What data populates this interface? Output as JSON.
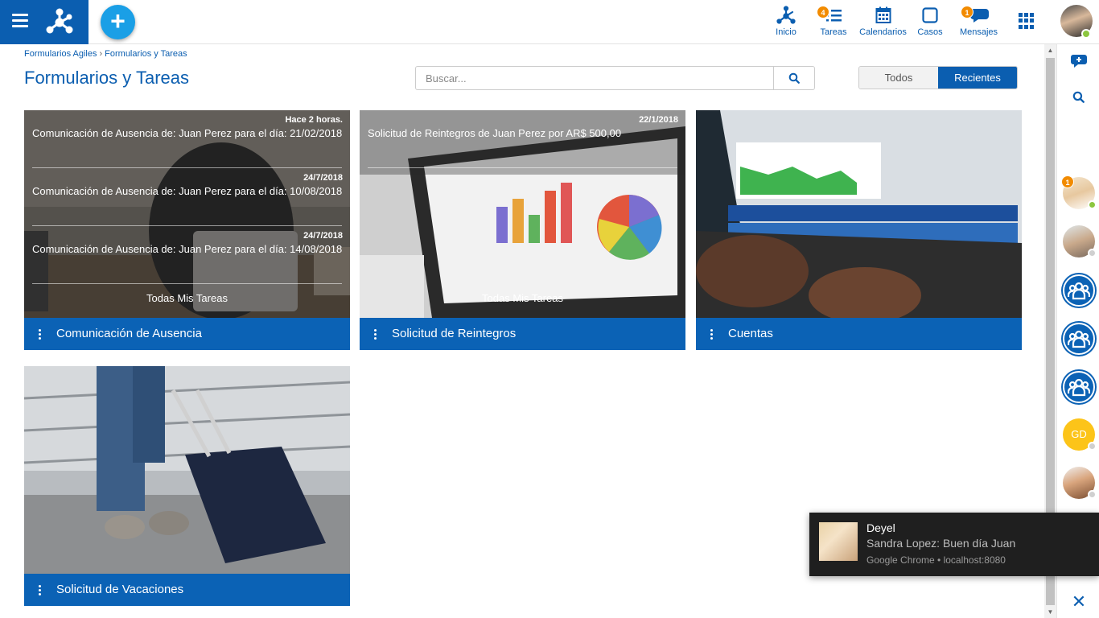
{
  "header": {
    "logo_icon": "deyel-logo-icon",
    "add_icon": "+",
    "nav": [
      {
        "label": "Inicio",
        "icon": "home-network-icon"
      },
      {
        "label": "Tareas",
        "icon": "tasks-icon",
        "badge": "4"
      },
      {
        "label": "Calendarios",
        "icon": "calendar-icon"
      },
      {
        "label": "Casos",
        "icon": "square-icon"
      },
      {
        "label": "Mensajes",
        "icon": "chat-icon",
        "badge": "1"
      }
    ]
  },
  "breadcrumb": {
    "items": [
      "Formularios Agiles",
      "Formularios y Tareas"
    ],
    "separator": "›"
  },
  "page": {
    "title": "Formularios y Tareas",
    "search_placeholder": "Buscar...",
    "toggle": {
      "all": "Todos",
      "recent": "Recientes"
    }
  },
  "cards": [
    {
      "title": "Comunicación de Ausencia",
      "tasks": [
        {
          "date": "Hace 2 horas.",
          "text": "Comunicación de Ausencia de: Juan Perez para el día: 21/02/2018"
        },
        {
          "date": "24/7/2018",
          "text": "Comunicación de Ausencia de: Juan Perez para el día: 10/08/2018"
        },
        {
          "date": "24/7/2018",
          "text": "Comunicación de Ausencia de: Juan Perez para el día: 14/08/2018"
        }
      ],
      "all_tasks": "Todas Mis Tareas"
    },
    {
      "title": "Solicitud de Reintegros",
      "tasks": [
        {
          "date": "22/1/2018",
          "text": "Solicitud de Reintegros de Juan  Perez por  AR$  500,00"
        }
      ],
      "all_tasks": "Todas Mis Tareas"
    },
    {
      "title": "Cuentas"
    },
    {
      "title": "Solicitud de Vacaciones"
    }
  ],
  "sidebar": {
    "contacts": [
      {
        "name": "contact-1",
        "badge": "1",
        "status": "online"
      },
      {
        "name": "contact-2",
        "status": "offline"
      },
      {
        "name": "group-1"
      },
      {
        "name": "group-2"
      },
      {
        "name": "group-3"
      },
      {
        "name": "contact-gd",
        "initials": "GD",
        "status": "offline"
      },
      {
        "name": "contact-3",
        "status": "offline"
      }
    ]
  },
  "notification": {
    "app": "Deyel",
    "message": "Sandra Lopez: Buen día Juan",
    "source": "Google Chrome • localhost:8080"
  },
  "colors": {
    "primary": "#0b5eb0",
    "accent": "#1a9fe6",
    "badge": "#f28b00",
    "online": "#8cc63f"
  }
}
